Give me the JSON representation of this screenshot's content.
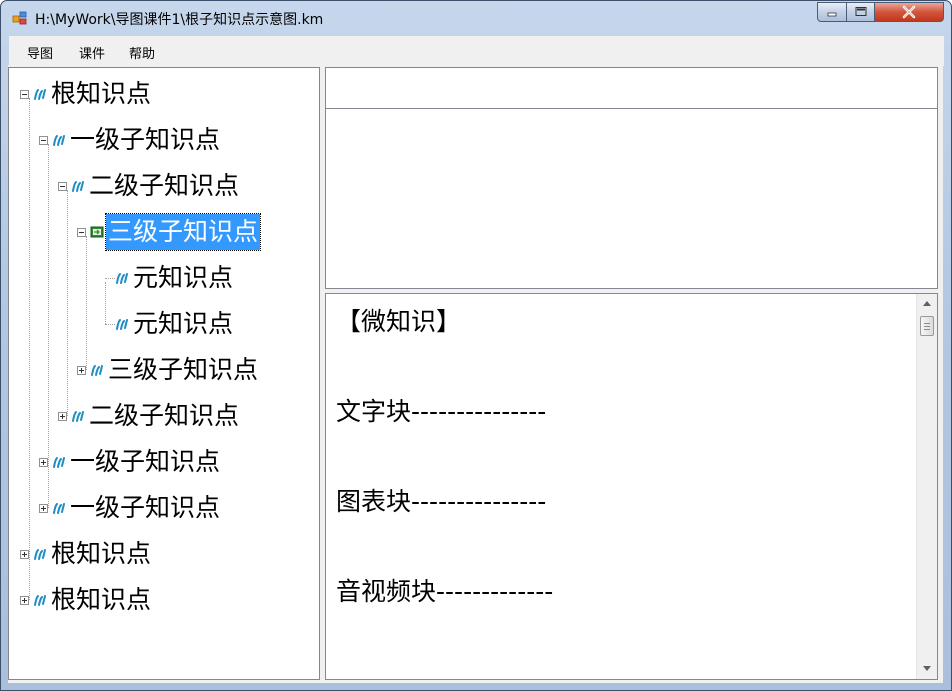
{
  "window": {
    "title": "H:\\MyWork\\导图课件1\\根子知识点示意图.km"
  },
  "menu": {
    "items": [
      "导图",
      "课件",
      "帮助"
    ]
  },
  "tree": {
    "nodes": [
      {
        "label": "根知识点",
        "expander": "minus",
        "icon": "knowledge-icon"
      },
      {
        "label": "一级子知识点",
        "expander": "minus",
        "icon": "knowledge-icon"
      },
      {
        "label": "二级子知识点",
        "expander": "minus",
        "icon": "knowledge-icon"
      },
      {
        "label": "三级子知识点",
        "expander": "minus",
        "icon": "courseware-icon",
        "selected": true
      },
      {
        "label": "元知识点",
        "expander": "none",
        "icon": "knowledge-icon"
      },
      {
        "label": "元知识点",
        "expander": "none",
        "icon": "knowledge-icon"
      },
      {
        "label": "三级子知识点",
        "expander": "plus",
        "icon": "knowledge-icon"
      },
      {
        "label": "二级子知识点",
        "expander": "plus",
        "icon": "knowledge-icon"
      },
      {
        "label": "一级子知识点",
        "expander": "plus",
        "icon": "knowledge-icon"
      },
      {
        "label": "一级子知识点",
        "expander": "plus",
        "icon": "knowledge-icon"
      },
      {
        "label": "根知识点",
        "expander": "plus",
        "icon": "knowledge-icon"
      },
      {
        "label": "根知识点",
        "expander": "plus",
        "icon": "knowledge-icon"
      }
    ]
  },
  "title_field": {
    "value": ""
  },
  "content": {
    "lines": [
      "【微知识】",
      "文字块---------------",
      "图表块---------------",
      "音视频块-------------"
    ]
  },
  "colors": {
    "selection": "#3399ff",
    "knowledge_icon": "#1c8ec4",
    "courseware_icon": "#2e8b2e"
  }
}
